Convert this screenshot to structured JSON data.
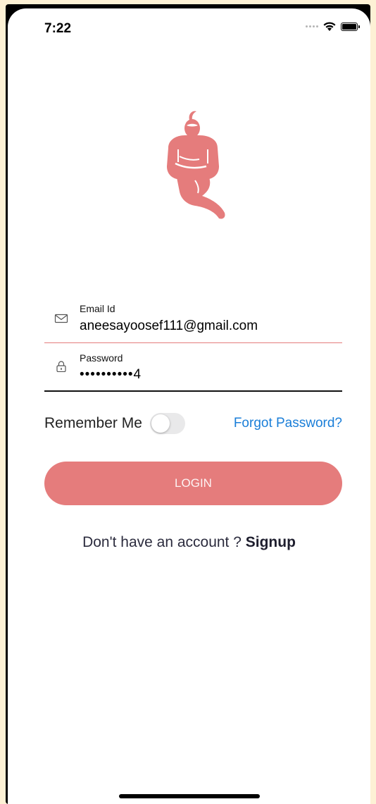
{
  "status_bar": {
    "time": "7:22"
  },
  "logo": {
    "icon": "genie-logo",
    "color": "#e57c7c"
  },
  "form": {
    "email": {
      "label": "Email Id",
      "value": "aneesayoosef111@gmail.com",
      "icon": "envelope-icon"
    },
    "password": {
      "label": "Password",
      "value": "••••••••••4",
      "icon": "lock-icon"
    }
  },
  "remember": {
    "label": "Remember Me",
    "enabled": false
  },
  "forgot_password": {
    "label": "Forgot Password?"
  },
  "login_button": {
    "label": "LOGIN"
  },
  "signup": {
    "prompt": "Don't have an account ? ",
    "link": "Signup"
  },
  "colors": {
    "accent": "#e57c7c",
    "link": "#1a7ed8"
  }
}
